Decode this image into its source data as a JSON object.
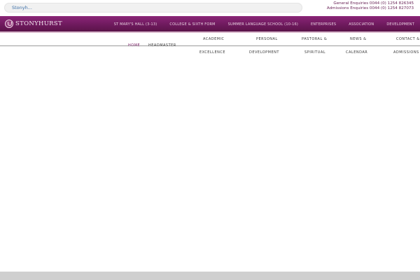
{
  "search": {
    "value": "Stonyh..."
  },
  "enquiries": {
    "general": "General Enquiries 0044 (0) 1254 826345",
    "admissions": "Admissions Enquiries 0044 (0) 1254 827073"
  },
  "brand": {
    "name": "STONYHURST"
  },
  "colors": {
    "brand": "#6f1a5e",
    "accent": "#7a1e66",
    "footer": "#cfcfcf"
  },
  "topnav": [
    "ST MARY'S HALL (3-13)",
    "COLLEGE & SIXTH FORM",
    "SUMMER LANGUAGE SCHOOL (10-16)",
    "ENTERPRISES",
    "ASSOCIATION",
    "DEVELOPMENT"
  ],
  "mainnav": {
    "home": "HOME",
    "headmaster": "HEADMASTER",
    "academic": [
      "ACADEMIC",
      "EXCELLENCE"
    ],
    "personal": [
      "PERSONAL",
      "DEVELOPMENT"
    ],
    "pastoral": [
      "PASTORAL &",
      "SPIRITUAL"
    ],
    "news": [
      "NEWS &",
      "CALENDAR"
    ],
    "contact": [
      "CONTACT &",
      "ADMISSIONS"
    ]
  }
}
